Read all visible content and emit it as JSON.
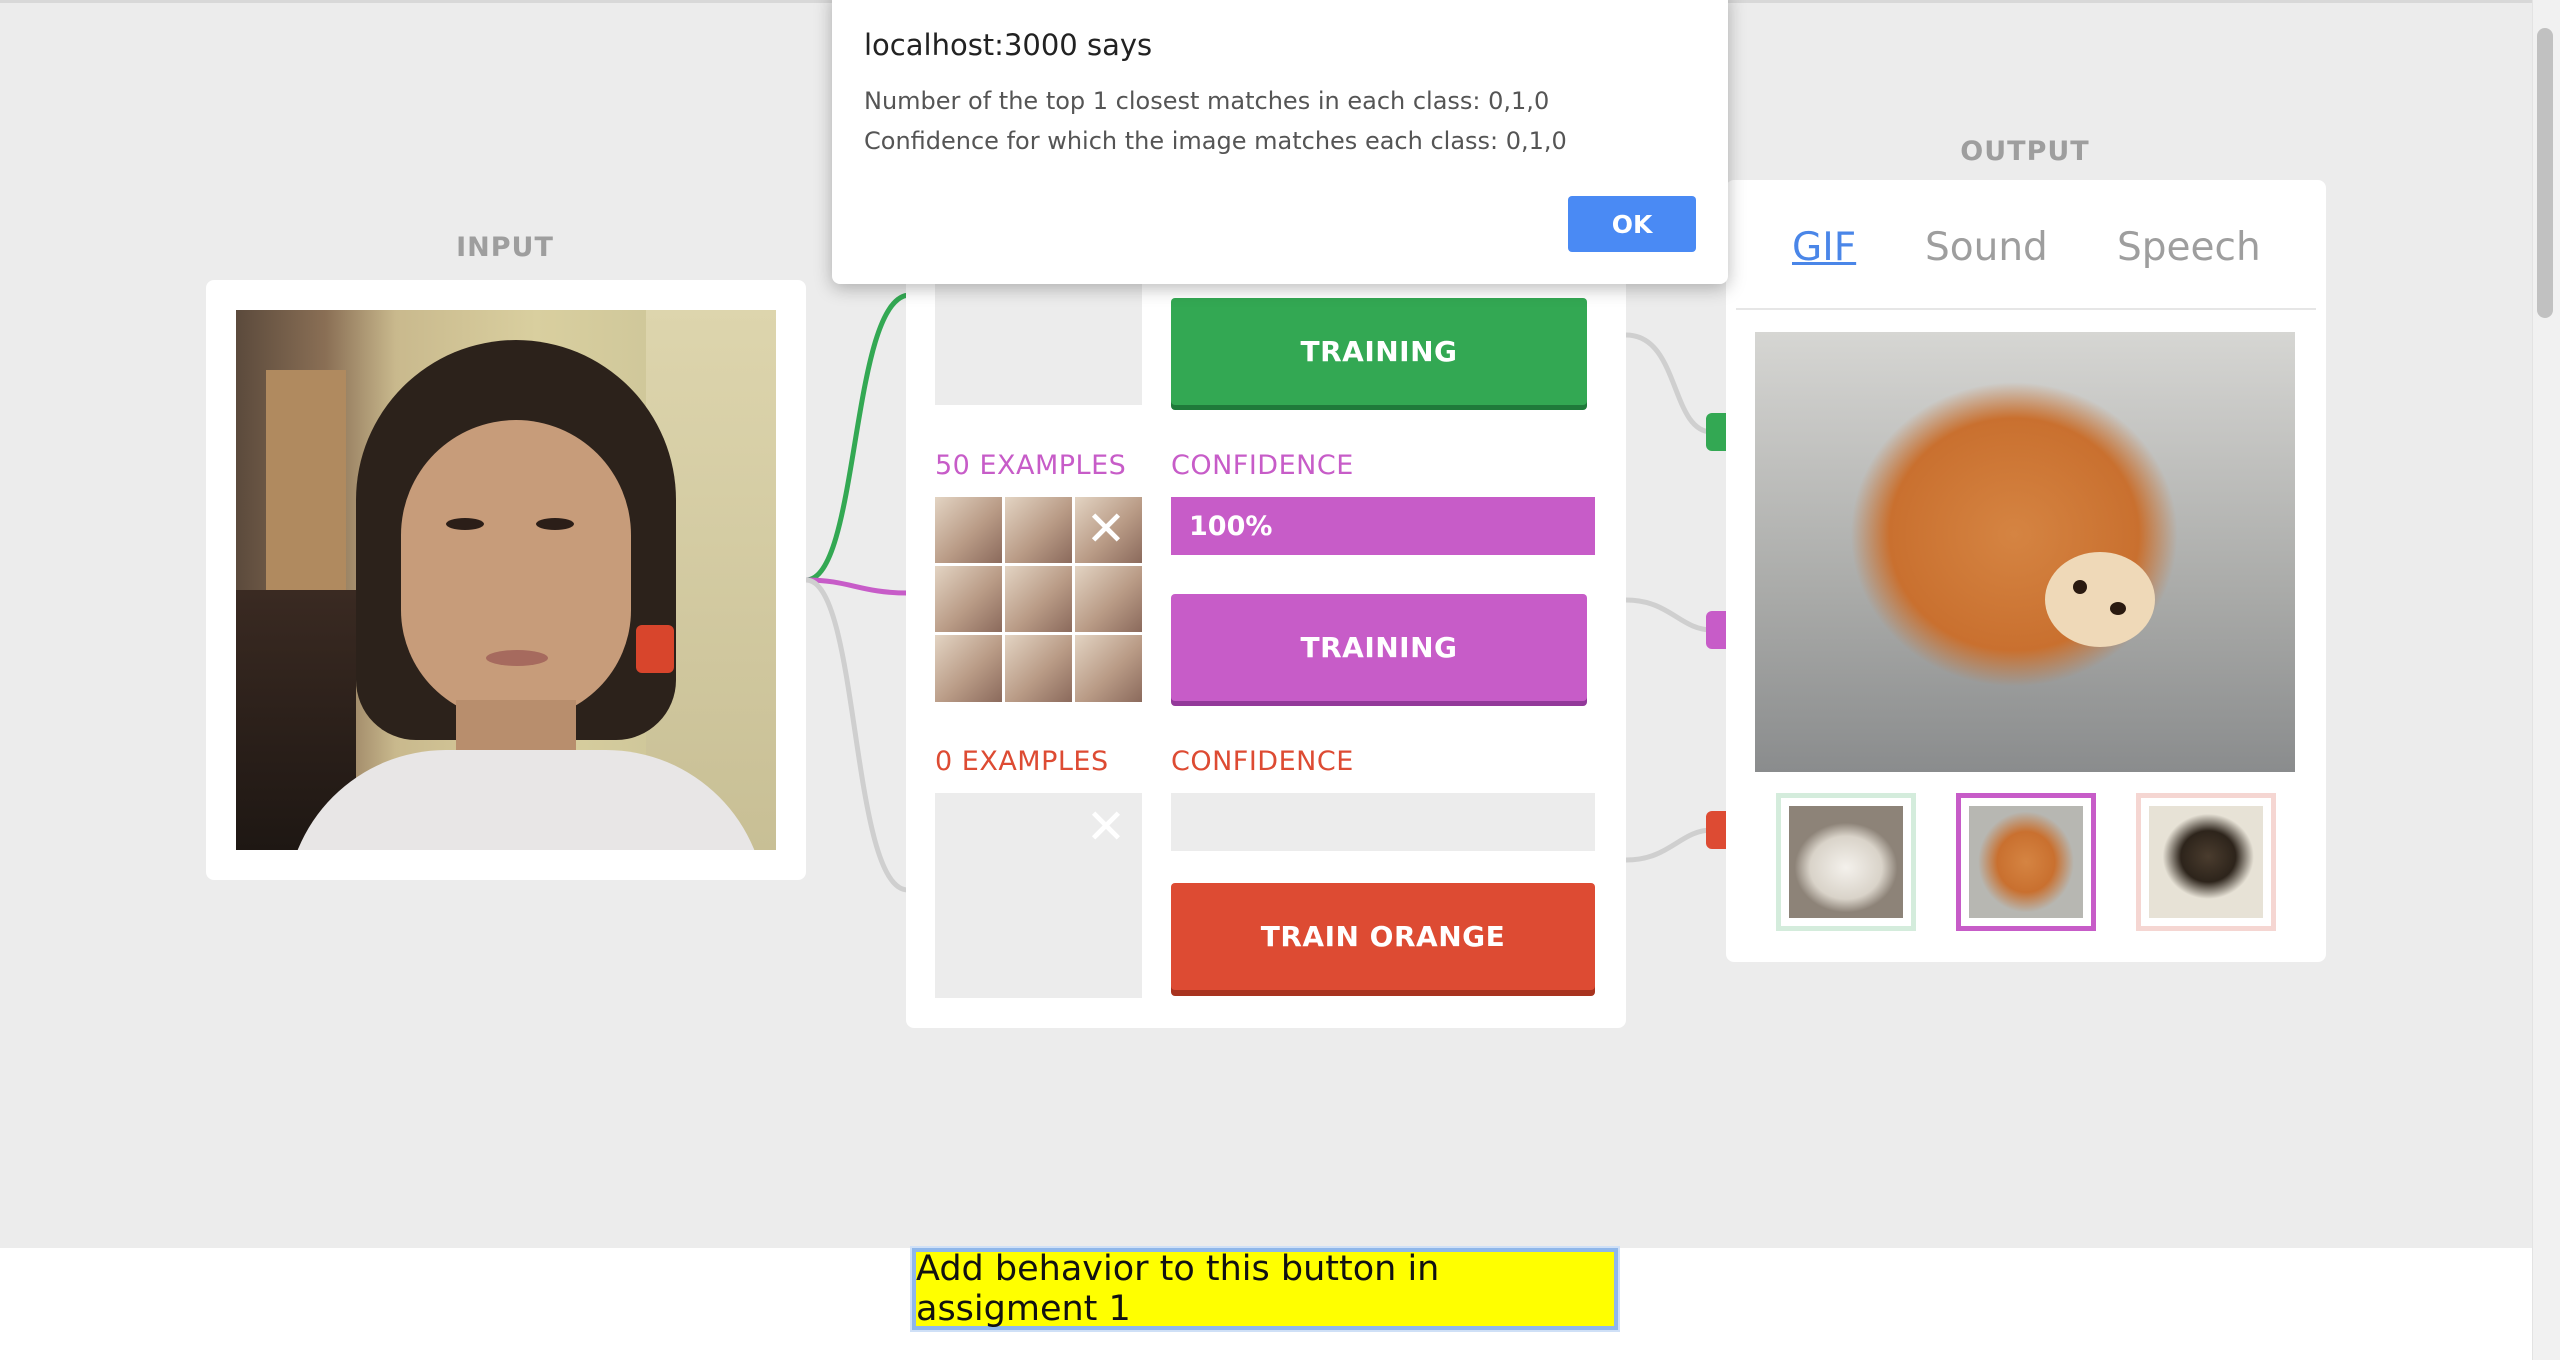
{
  "input": {
    "heading": "INPUT"
  },
  "trainer": {
    "rows": [
      {
        "examples_label": "",
        "confidence_label": "",
        "button_label": "TRAINING",
        "confidence_value": "",
        "color": "#33a853"
      },
      {
        "examples_label": "50 EXAMPLES",
        "confidence_label": "CONFIDENCE",
        "confidence_value": "100%",
        "confidence_fraction": 1.0,
        "button_label": "TRAINING",
        "color": "#c75cc8"
      },
      {
        "examples_label": "0 EXAMPLES",
        "confidence_label": "CONFIDENCE",
        "confidence_value": "",
        "confidence_fraction": 0.0,
        "button_label": "TRAIN ORANGE",
        "color": "#dd4b33"
      }
    ]
  },
  "output": {
    "heading": "OUTPUT",
    "tabs": [
      {
        "label": "GIF",
        "active": true
      },
      {
        "label": "Sound",
        "active": false
      },
      {
        "label": "Speech",
        "active": false
      }
    ],
    "thumb_colors": [
      "#d4ecdc",
      "#c75cc8",
      "#f5d6d2"
    ]
  },
  "dialog": {
    "title": "localhost:3000 says",
    "line1": "Number of the top 1 closest matches in each class: 0,1,0",
    "line2": "Confidence for which the image matches each class: 0,1,0",
    "ok_label": "OK"
  },
  "bottom": {
    "button_label": "Add behavior to this button in assigment 1"
  },
  "colors": {
    "green": "#33a853",
    "purple": "#c75cc8",
    "orange": "#dd4b33",
    "accent": "#4a86e8"
  }
}
